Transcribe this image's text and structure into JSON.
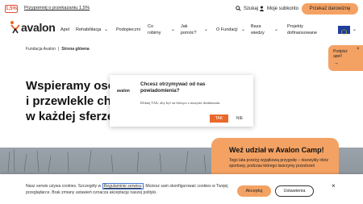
{
  "topbar": {
    "one_percent_badge": "1,5%",
    "remind_link": "Przypomnij o przekazaniu 1,5%",
    "search_label": "Szukaj",
    "account_label": "Moje subkonto",
    "donate_label": "Przekaż darowiznę"
  },
  "nav": {
    "logo_text": "avalon",
    "items": [
      "Apel",
      "Rehabilitacja",
      "Podopieczni",
      "Co",
      "robimy",
      "Jak",
      "pomóc?",
      "O Fundacji",
      "Baza",
      "wiedzy",
      "Projekty",
      "dofinansowane"
    ]
  },
  "breadcrumb": {
    "home": "Fundacja Avalon",
    "current": "Strona główna"
  },
  "hero": {
    "title_line1": "Wspieramy osob",
    "title_line2": "i przewlekle cho",
    "title_line3": "w każdej sferze ż"
  },
  "notification": {
    "logo": "avalon",
    "question": "Chcesz otrzymywać od nas powiadomienia?",
    "hint": "Kliknij TAK, aby być na bieżąco z naszymi działaniami.",
    "yes": "TAK",
    "no": "NIE"
  },
  "subscribe_tab": {
    "line1": "Podpisz",
    "line2": "apel!",
    "arrow": "→",
    "close": "×"
  },
  "camp": {
    "title": "Weź udział w Avalon Camp!",
    "text": "Tego lata przeżyj wyjątkową przygodę – niezwykły obóz sportowy, podczas którego tworzymy przestrzeń"
  },
  "cookie": {
    "text_before": "Nasz serwis używa cookies. Szczegóły w ",
    "link": "Regulaminie serwisu",
    "text_after": ". Możesz sam skonfigurować cookies w Twojej przeglądarce. Brak zmiany ustawień oznacza akceptację naszej polityki.",
    "accept": "Akceptuj",
    "settings": "Ustawienia",
    "close": "×"
  },
  "colors": {
    "accent": "#f3a263",
    "notif_button": "#e9692c",
    "eu_blue": "#1f3f9a"
  }
}
